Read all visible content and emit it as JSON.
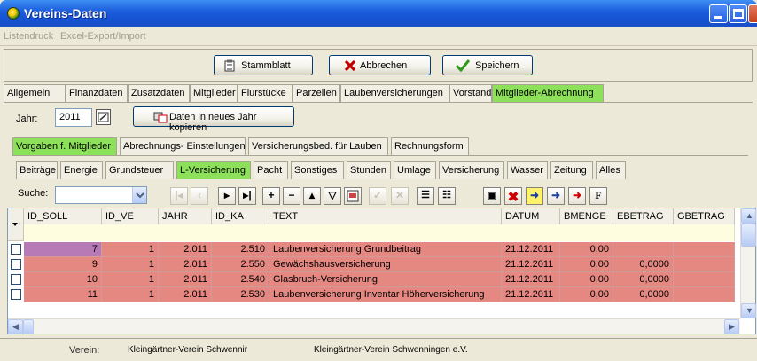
{
  "window": {
    "title": "Vereins-Daten"
  },
  "menu": [
    "Listendruck",
    "Excel-Export/Import"
  ],
  "actions": {
    "stammblatt": "Stammblatt",
    "abbrechen": "Abbrechen",
    "speichern": "Speichern"
  },
  "main_tabs": [
    "Allgemein",
    "Finanzdaten",
    "Zusatzdaten",
    "Mitglieder",
    "Flurstücke",
    "Parzellen",
    "Laubenversicherungen",
    "Vorstand",
    "Mitglieder-Abrechnung"
  ],
  "main_tabs_active": "Mitglieder-Abrechnung",
  "year": {
    "label": "Jahr:",
    "value": "2011",
    "copy_button": "Daten in neues Jahr kopieren"
  },
  "sub_tabs": [
    "Vorgaben f. Mitglieder",
    "Abrechnungs- Einstellungen",
    "Versicherungsbed. für Lauben",
    "Rechnungsform"
  ],
  "sub_tabs_active": "Vorgaben f. Mitglieder",
  "cat_tabs": [
    "Beiträge",
    "Energie",
    "Grundsteuer",
    "L-Versicherung",
    "Pacht",
    "Sonstiges",
    "Stunden",
    "Umlage",
    "Versicherung",
    "Wasser",
    "Zeitung",
    "Alles"
  ],
  "cat_tabs_active": "L-Versicherung",
  "search": {
    "label": "Suche:",
    "value": ""
  },
  "grid": {
    "columns": [
      "ID_SOLL",
      "ID_VE",
      "JAHR",
      "ID_KA",
      "TEXT",
      "DATUM",
      "BMENGE",
      "EBETRAG",
      "GBETRAG"
    ],
    "rows": [
      [
        "7",
        "1",
        "2.011",
        "2.510",
        "Laubenversicherung Grundbeitrag",
        "21.12.2011",
        "0,00",
        "",
        ""
      ],
      [
        "9",
        "1",
        "2.011",
        "2.550",
        "Gewächshausversicherung",
        "21.12.2011",
        "0,00",
        "0,0000",
        ""
      ],
      [
        "10",
        "1",
        "2.011",
        "2.540",
        "Glasbruch-Versicherung",
        "21.12.2011",
        "0,00",
        "0,0000",
        ""
      ],
      [
        "11",
        "1",
        "2.011",
        "2.530",
        "Laubenversicherung Inventar Höherversicherung",
        "21.12.2011",
        "0,00",
        "0,0000",
        ""
      ]
    ],
    "selected_row": 0
  },
  "status": {
    "label": "Verein:",
    "short": "Kleingärtner-Verein Schwennir",
    "full": "Kleingärtner-Verein Schwenningen e.V."
  },
  "colors": {
    "accent_tab": "#8de05a",
    "row_highlight": "#e68882",
    "title_bar": "#1553d4"
  }
}
